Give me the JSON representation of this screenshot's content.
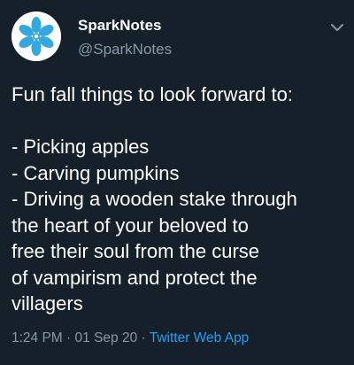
{
  "author": {
    "display_name": "SparkNotes",
    "handle": "@SparkNotes",
    "avatar_icon": "sparknotes-logo-icon",
    "avatar_color": "#33a8e0"
  },
  "menu": {
    "icon": "chevron-down-icon"
  },
  "tweet": {
    "lines": [
      "Fun fall things to look forward to:",
      "",
      "- Picking apples",
      "- Carving pumpkins",
      "- Driving a wooden stake through",
      "the heart of your beloved to",
      "free their soul from the curse",
      "of vampirism and protect the",
      "villagers"
    ]
  },
  "meta": {
    "time": "1:24 PM",
    "separator": "·",
    "date": "01 Sep 20",
    "source": "Twitter Web App"
  },
  "colors": {
    "background": "#15202b",
    "primary_text": "#ffffff",
    "secondary_text": "#8899a6",
    "link": "#1da1f2"
  }
}
